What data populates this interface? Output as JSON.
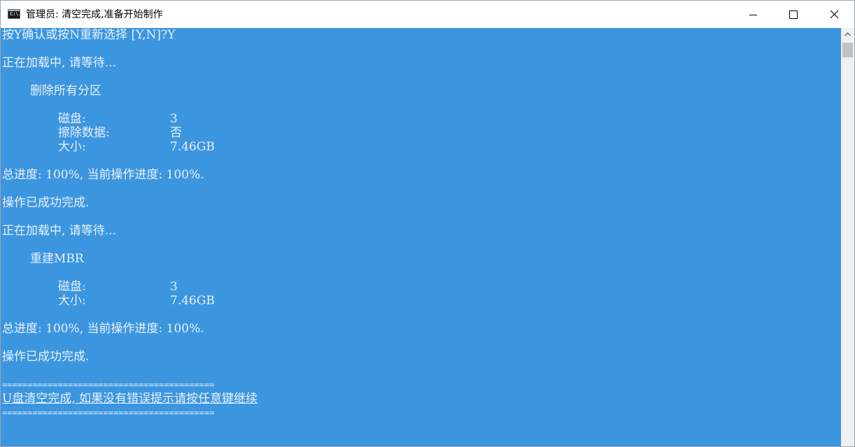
{
  "window": {
    "title": "管理员: 清空完成,准备开始制作",
    "icon": "cmd-icon",
    "icon_text": "C:\\.",
    "console_bg": "#3c96df",
    "console_fg": "#e8f1fb"
  },
  "console": {
    "lines": {
      "l1": "按Y确认或按N重新选择 [Y,N]?Y",
      "l2": "正在加载中, 请等待...",
      "l3": "删除所有分区",
      "disk1_key": "磁盘:",
      "disk1_val": "3",
      "erase_key": "擦除数据:",
      "erase_val": "否",
      "size1_key": "大小:",
      "size1_val": "7.46GB",
      "progress1": "总进度: 100%, 当前操作进度: 100%.",
      "done1": "操作已成功完成.",
      "l_loading2": "正在加载中, 请等待...",
      "rebuild": "重建MBR",
      "disk2_key": "磁盘:",
      "disk2_val": "3",
      "size2_key": "大小:",
      "size2_val": "7.46GB",
      "progress2": "总进度: 100%, 当前操作进度: 100%.",
      "done2": "操作已成功完成.",
      "rule_top": "==========================================",
      "final_msg": "U盘清空完成, 如果没有错误提示请按任意键继续",
      "rule_bottom": "=========================================="
    }
  }
}
